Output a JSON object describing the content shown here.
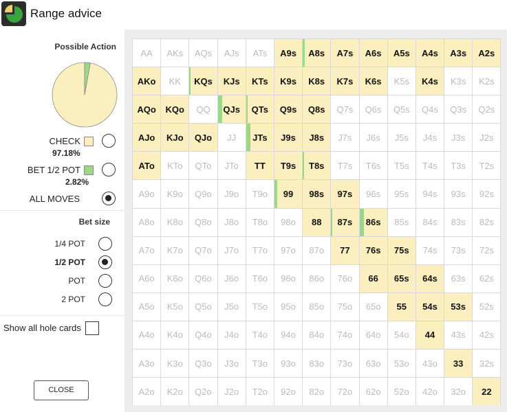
{
  "window": {
    "title": "Range advice",
    "icon": "pie-chart-icon"
  },
  "possible_action": {
    "title": "Possible Action",
    "chart_data": {
      "type": "pie",
      "slices": [
        {
          "label": "CHECK",
          "value": 97.18,
          "color": "#fbefc0"
        },
        {
          "label": "BET 1/2 POT",
          "value": 2.82,
          "color": "#9dd885"
        }
      ]
    },
    "options": [
      {
        "label": "CHECK",
        "pct": "97.18%",
        "color": "#fbefc0",
        "selected": false
      },
      {
        "label": "BET 1/2 POT",
        "pct": "2.82%",
        "color": "#9dd885",
        "selected": false
      },
      {
        "label": "ALL MOVES",
        "selected": true
      }
    ]
  },
  "bet_size": {
    "title": "Bet size",
    "options": [
      {
        "label": "1/4 POT",
        "selected": false
      },
      {
        "label": "1/2 POT",
        "selected": true
      },
      {
        "label": "POT",
        "selected": false
      },
      {
        "label": "2 POT",
        "selected": false
      }
    ]
  },
  "show_all": {
    "label": "Show all hole cards",
    "checked": false
  },
  "close_label": "CLOSE",
  "colors": {
    "check": "#fbefc0",
    "bet": "#9dd885",
    "inactive_text": "#bbbbbb"
  },
  "grid": {
    "ranks": [
      "A",
      "K",
      "Q",
      "J",
      "T",
      "9",
      "8",
      "7",
      "6",
      "5",
      "4",
      "3",
      "2"
    ],
    "rows": [
      [
        "AA",
        "AKs",
        "AQs",
        "AJs",
        "ATs",
        "A9s",
        "A8s",
        "A7s",
        "A6s",
        "A5s",
        "A4s",
        "A3s",
        "A2s"
      ],
      [
        "AKo",
        "KK",
        "KQs",
        "KJs",
        "KTs",
        "K9s",
        "K8s",
        "K7s",
        "K6s",
        "K5s",
        "K4s",
        "K3s",
        "K2s"
      ],
      [
        "AQo",
        "KQo",
        "QQ",
        "QJs",
        "QTs",
        "Q9s",
        "Q8s",
        "Q7s",
        "Q6s",
        "Q5s",
        "Q4s",
        "Q3s",
        "Q2s"
      ],
      [
        "AJo",
        "KJo",
        "QJo",
        "JJ",
        "JTs",
        "J9s",
        "J8s",
        "J7s",
        "J6s",
        "J5s",
        "J4s",
        "J3s",
        "J2s"
      ],
      [
        "ATo",
        "KTo",
        "QTo",
        "JTo",
        "TT",
        "T9s",
        "T8s",
        "T7s",
        "T6s",
        "T5s",
        "T4s",
        "T3s",
        "T2s"
      ],
      [
        "A9o",
        "K9o",
        "Q9o",
        "J9o",
        "T9o",
        "99",
        "98s",
        "97s",
        "96s",
        "95s",
        "94s",
        "93s",
        "92s"
      ],
      [
        "A8o",
        "K8o",
        "Q8o",
        "J8o",
        "T8o",
        "98o",
        "88",
        "87s",
        "86s",
        "85s",
        "84s",
        "83s",
        "82s"
      ],
      [
        "A7o",
        "K7o",
        "Q7o",
        "J7o",
        "T7o",
        "97o",
        "87o",
        "77",
        "76s",
        "75s",
        "74s",
        "73s",
        "72s"
      ],
      [
        "A6o",
        "K6o",
        "Q6o",
        "J6o",
        "T6o",
        "96o",
        "86o",
        "76o",
        "66",
        "65s",
        "64s",
        "63s",
        "62s"
      ],
      [
        "A5o",
        "K5o",
        "Q5o",
        "J5o",
        "T5o",
        "95o",
        "85o",
        "75o",
        "65o",
        "55",
        "54s",
        "53s",
        "52s"
      ],
      [
        "A4o",
        "K4o",
        "Q4o",
        "J4o",
        "T4o",
        "94o",
        "84o",
        "74o",
        "64o",
        "54o",
        "44",
        "43s",
        "42s"
      ],
      [
        "A3o",
        "K3o",
        "Q3o",
        "J3o",
        "T3o",
        "93o",
        "83o",
        "73o",
        "63o",
        "53o",
        "43o",
        "33",
        "32s"
      ],
      [
        "A2o",
        "K2o",
        "Q2o",
        "J2o",
        "T2o",
        "92o",
        "82o",
        "72o",
        "62o",
        "52o",
        "42o",
        "32o",
        "22"
      ]
    ],
    "active_hands": [
      "A9s",
      "A8s",
      "A7s",
      "A6s",
      "A5s",
      "A4s",
      "A3s",
      "A2s",
      "AKo",
      "KQs",
      "KJs",
      "KTs",
      "K9s",
      "K8s",
      "K7s",
      "K6s",
      "K4s",
      "AQo",
      "KQo",
      "QJs",
      "QTs",
      "Q9s",
      "Q8s",
      "AJo",
      "KJo",
      "QJo",
      "JTs",
      "J9s",
      "J8s",
      "ATo",
      "TT",
      "T9s",
      "T8s",
      "99",
      "98s",
      "97s",
      "88",
      "87s",
      "86s",
      "77",
      "76s",
      "75s",
      "66",
      "65s",
      "64s",
      "55",
      "54s",
      "53s",
      "44",
      "33",
      "22"
    ],
    "bet_fractions": {
      "A8s": 0.06,
      "KQs": 0.05,
      "QJs": 0.15,
      "QTs": 0.06,
      "JTs": 0.15,
      "T8s": 0.05,
      "99": 0.09,
      "87s": 0.05,
      "86s": 0.15
    }
  }
}
